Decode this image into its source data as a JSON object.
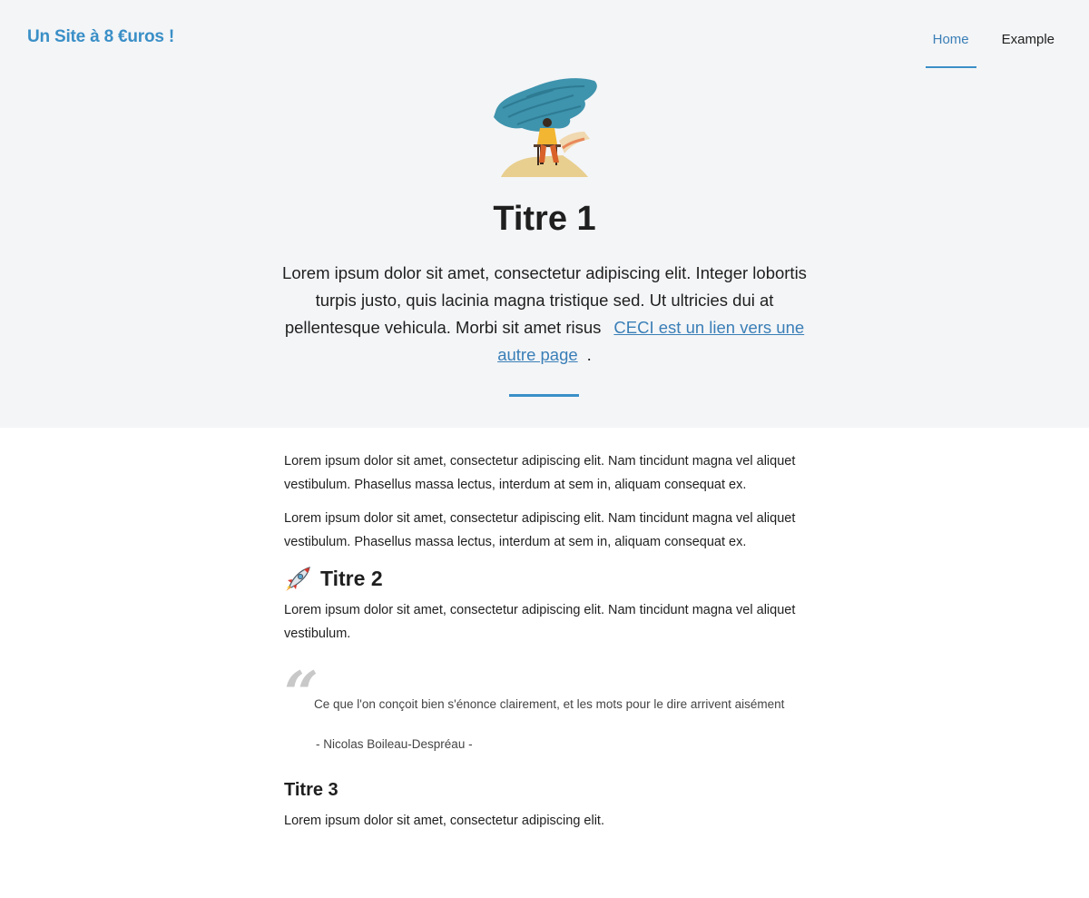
{
  "header": {
    "site_title": "Un Site à 8 €uros !",
    "nav": [
      {
        "label": "Home",
        "active": true
      },
      {
        "label": "Example",
        "active": false
      }
    ]
  },
  "hero": {
    "title": "Titre 1",
    "text": "Lorem ipsum dolor sit amet, consectetur adipiscing elit. Integer lobortis turpis justo, quis lacinia magna tristique sed. Ut ultricies dui at pellentesque vehicula. Morbi sit amet risus",
    "link_text": "CECI est un lien vers une autre page",
    "trailing": ".",
    "illustration_icon": "writer-under-tree-illustration"
  },
  "content": {
    "paragraph_1": "Lorem ipsum dolor sit amet, consectetur adipiscing elit. Nam tincidunt magna vel aliquet vestibulum. Phasellus massa lectus, interdum at sem in, aliquam consequat ex.",
    "paragraph_2": "Lorem ipsum dolor sit amet, consectetur adipiscing elit. Nam tincidunt magna vel aliquet vestibulum. Phasellus massa lectus, interdum at sem in, aliquam consequat ex.",
    "heading_2": "Titre 2",
    "heading_2_icon": "rocket-icon",
    "paragraph_3": "Lorem ipsum dolor sit amet, consectetur adipiscing elit. Nam tincidunt magna vel aliquet vestibulum.",
    "quote": {
      "mark": "“",
      "text": "Ce que l'on conçoit bien s'énonce clairement, et les mots pour le dire arrivent aisément",
      "author": "- Nicolas Boileau-Despréau -"
    },
    "heading_3": "Titre 3",
    "paragraph_4": "Lorem ipsum dolor sit amet, consectetur adipiscing elit."
  },
  "colors": {
    "accent": "#3a8fc7",
    "hero_background": "#f4f5f7",
    "text": "#1f1f1f"
  }
}
